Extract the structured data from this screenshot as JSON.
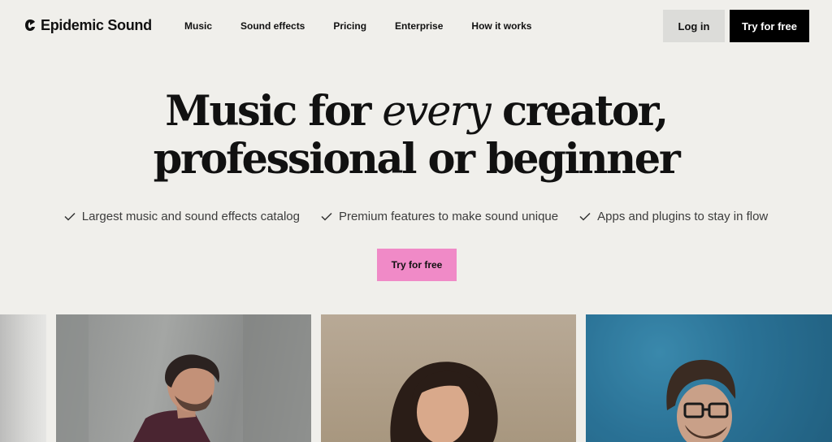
{
  "header": {
    "brand": "Epidemic Sound",
    "nav": [
      "Music",
      "Sound effects",
      "Pricing",
      "Enterprise",
      "How it works"
    ],
    "login_label": "Log in",
    "try_label": "Try for free"
  },
  "hero": {
    "title_part1": "Music for ",
    "title_emphasis": "every",
    "title_part2": " creator,",
    "title_line2": "professional or beginner",
    "features": [
      "Largest music and sound effects catalog",
      "Premium features to make sound unique",
      "Apps and plugins to stay in flow"
    ],
    "cta_label": "Try for free"
  },
  "colors": {
    "background": "#f0efeb",
    "cta_pink": "#f08ac7",
    "header_cta": "#000000",
    "login_bg": "#dcdcd9"
  },
  "icons": [
    "epidemic-logo-icon",
    "check-icon"
  ]
}
